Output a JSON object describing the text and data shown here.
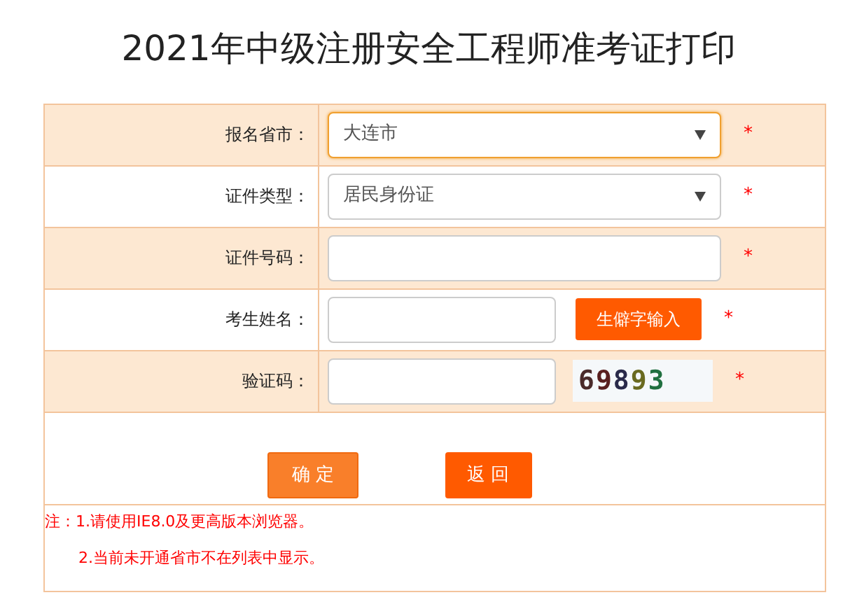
{
  "title": "2021年中级注册安全工程师准考证打印",
  "rows": [
    {
      "label": "报名省市：",
      "kind": "select",
      "value": "大连市",
      "focused": true,
      "required": "*"
    },
    {
      "label": "证件类型：",
      "kind": "select",
      "value": "居民身份证",
      "focused": false,
      "required": "*"
    },
    {
      "label": "证件号码：",
      "kind": "input",
      "focused": false,
      "required": "*"
    },
    {
      "label": "考生姓名：",
      "kind": "input_button",
      "button": "生僻字输入",
      "focused": false,
      "required": "*"
    },
    {
      "label": "验证码：",
      "kind": "captcha",
      "captcha": "69893",
      "focused": false,
      "required": "*"
    }
  ],
  "buttons": [
    {
      "label": "确 定",
      "kind": "confirm"
    },
    {
      "label": "返 回",
      "kind": "back"
    }
  ],
  "notes": [
    "注：1.请使用IE8.0及更高版本浏览器。",
    "2.当前未开通省市不在列表中显示。"
  ]
}
